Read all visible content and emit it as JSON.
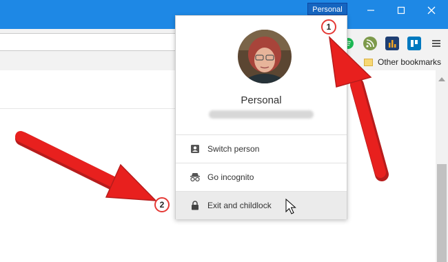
{
  "window": {
    "profile_button": "Personal",
    "minimize_label": "minimize",
    "maximize_label": "maximize",
    "close_label": "close"
  },
  "toolbar": {
    "extension_icons": [
      "spotify-like-icon",
      "feedly-icon",
      "analytics-icon",
      "trello-icon",
      "menu-icon"
    ]
  },
  "bookmarks_bar": {
    "other_bookmarks": "Other bookmarks"
  },
  "profile_menu": {
    "name": "Personal",
    "email": "",
    "items": [
      {
        "label": "Switch person",
        "icon": "person-card-icon"
      },
      {
        "label": "Go incognito",
        "icon": "incognito-icon"
      },
      {
        "label": "Exit and childlock",
        "icon": "lock-icon",
        "hovered": true
      }
    ]
  },
  "annotations": {
    "callout_1": "1",
    "callout_2": "2",
    "arrow_color": "#e8201e"
  },
  "colors": {
    "titlebar": "#1e88e5",
    "menu_hover": "#ebebeb"
  }
}
